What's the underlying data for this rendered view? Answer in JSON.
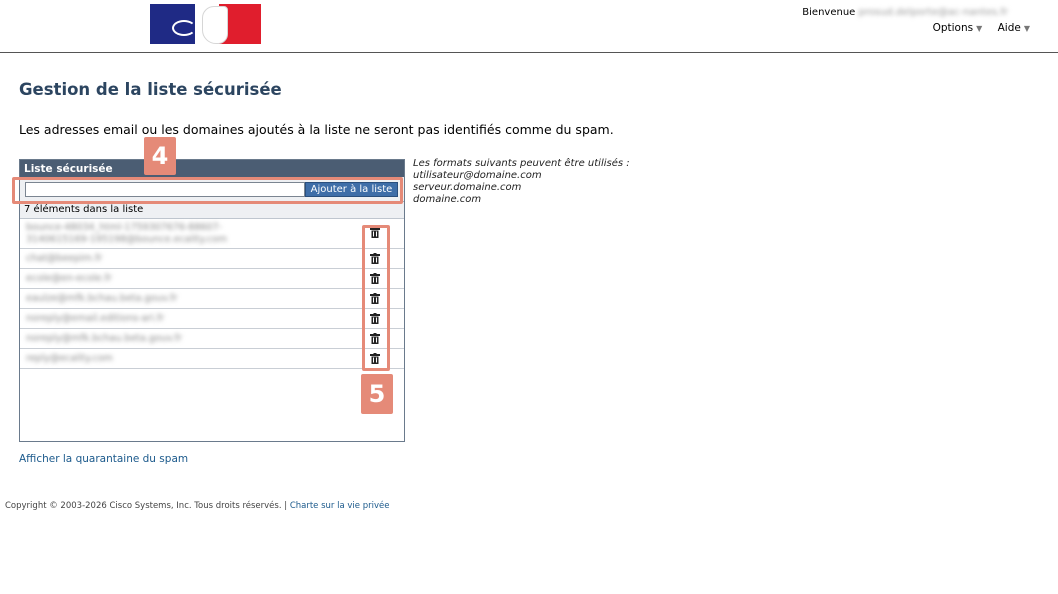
{
  "header": {
    "welcome_label": "Bienvenue",
    "user_email": "prosud.delporte@ac-nantes.fr",
    "menu": [
      {
        "label": "Options"
      },
      {
        "label": "Aide"
      }
    ]
  },
  "page": {
    "title": "Gestion de la liste sécurisée",
    "intro": "Les adresses email ou les domaines ajoutés à la liste ne seront pas identifiés comme du spam."
  },
  "safelist": {
    "header": "Liste sécurisée",
    "input_value": "",
    "add_button": "Ajouter à la liste",
    "count_label": "7 éléments dans la liste",
    "items": [
      {
        "address_line1": "bounce-48034_html-1759307676-88607-",
        "address_line2": "3140615169-195198@bounce.ecality.com"
      },
      {
        "address_line1": "chat@beepim.fr"
      },
      {
        "address_line1": "ecole@en-ecole.fr"
      },
      {
        "address_line1": "eaulze@mfk.bchau.beta.gouv.fr"
      },
      {
        "address_line1": "noreply@email.editions-ari.fr"
      },
      {
        "address_line1": "noreply@mfk.bchau.beta.gouv.fr"
      },
      {
        "address_line1": "reply@ecality.com"
      }
    ]
  },
  "formats": {
    "heading": "Les formats suivants peuvent être utilisés :",
    "examples": [
      "utilisateur@domaine.com",
      "serveur.domaine.com",
      "domaine.com"
    ]
  },
  "annotations": {
    "label_4": "4",
    "label_5": "5",
    "color": "#e58a78"
  },
  "links": {
    "quarantine": "Afficher la quarantaine du spam"
  },
  "footer": {
    "copyright": "Copyright © 2003-2026 Cisco Systems, Inc. Tous droits réservés. |",
    "privacy": "Charte sur la vie privée"
  },
  "colors": {
    "title": "#2c4560",
    "panel_header": "#4b5d73",
    "button": "#3f6ea8",
    "link": "#1c5a8c"
  }
}
